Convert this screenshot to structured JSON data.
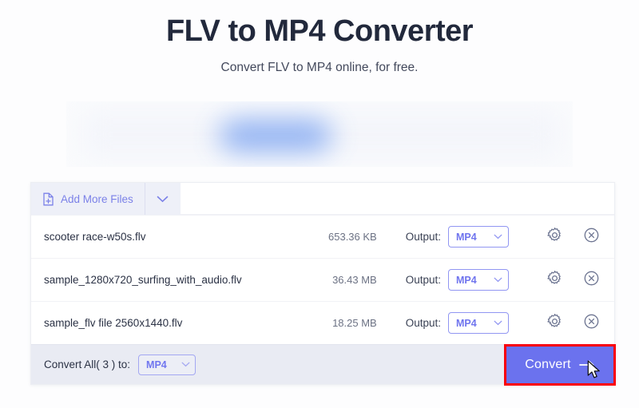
{
  "header": {
    "title": "FLV to MP4 Converter",
    "subtitle": "Convert FLV to MP4 online, for free."
  },
  "toolbar": {
    "add_more_files_label": "Add More Files",
    "add_icon": "file-plus-icon",
    "caret_icon": "chevron-down-icon"
  },
  "table": {
    "output_label": "Output:",
    "rows": [
      {
        "name": "scooter race-w50s.flv",
        "size": "653.36 KB",
        "output_format": "MP4",
        "settings_icon": "gear-icon",
        "remove_icon": "close-circle-icon"
      },
      {
        "name": "sample_1280x720_surfing_with_audio.flv",
        "size": "36.43 MB",
        "output_format": "MP4",
        "settings_icon": "gear-icon",
        "remove_icon": "close-circle-icon"
      },
      {
        "name": "sample_flv file 2560x1440.flv",
        "size": "18.25 MB",
        "output_format": "MP4",
        "settings_icon": "gear-icon",
        "remove_icon": "close-circle-icon"
      }
    ]
  },
  "footer": {
    "convert_all_label": "Convert All( 3 ) to:",
    "convert_all_format": "MP4",
    "convert_button_label": "Convert",
    "convert_button_icon": "arrow-right-icon"
  },
  "colors": {
    "accent_purple": "#6b72ee",
    "select_border": "#9196f2",
    "highlight_red": "#fb0007",
    "tab_bg": "#eef0f8",
    "footer_bg": "#e9ebf3",
    "title": "#22293c",
    "icon_slate": "#6b7390"
  }
}
